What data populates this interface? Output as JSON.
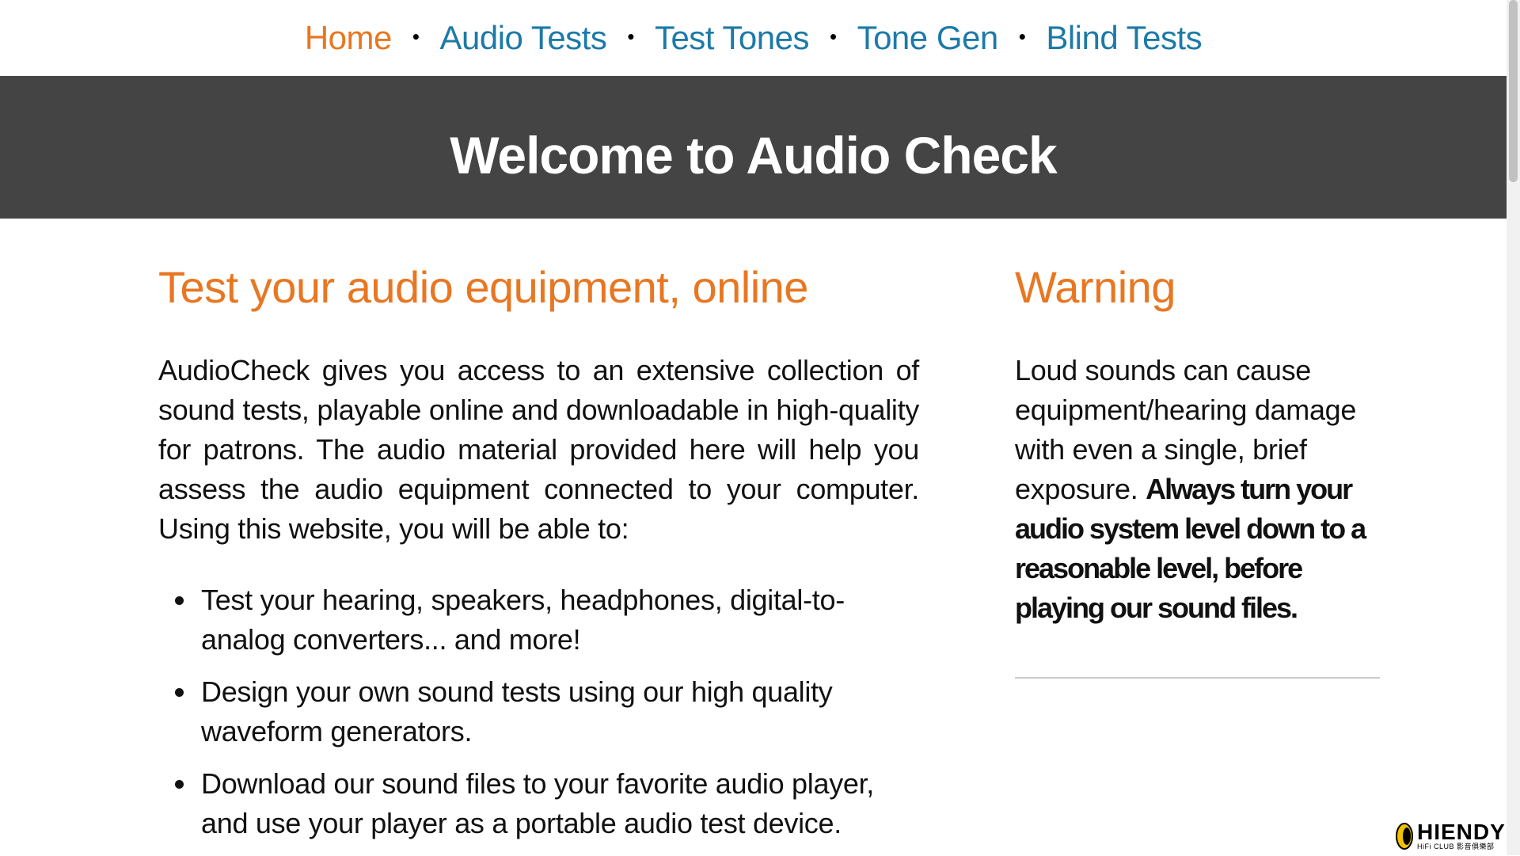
{
  "nav": {
    "items": [
      {
        "label": "Home"
      },
      {
        "label": "Audio Tests"
      },
      {
        "label": "Test Tones"
      },
      {
        "label": "Tone Gen"
      },
      {
        "label": "Blind Tests"
      }
    ],
    "separator": "•",
    "active_color": "#e87722",
    "link_color": "#1c7aa8"
  },
  "banner": {
    "title": "Welcome to Audio Check",
    "background": "#444444"
  },
  "main": {
    "title": "Test your audio equipment, online",
    "intro": "AudioCheck gives you access to an extensive collection of sound tests, playable online and downloadable in high-quality for patrons. The audio material provided here will help you assess the audio equipment connected to your computer. Using this website, you will be able to:",
    "features": [
      "Test your hearing, speakers, headphones, digital-to-analog converters... and more!",
      "Design your own sound tests using our high quality waveform generators.",
      "Download our sound files to your favorite audio player, and use your player as a portable audio test device."
    ]
  },
  "sidebar": {
    "title": "Warning",
    "text": "Loud sounds can cause equipment/hearing damage with even a single, brief exposure.",
    "bold_text": "Always turn your audio system level down to a reasonable level, before playing our sound files."
  },
  "watermark": {
    "brand": "HIENDY",
    "sub": "HiFi CLUB 影音俱樂部"
  }
}
